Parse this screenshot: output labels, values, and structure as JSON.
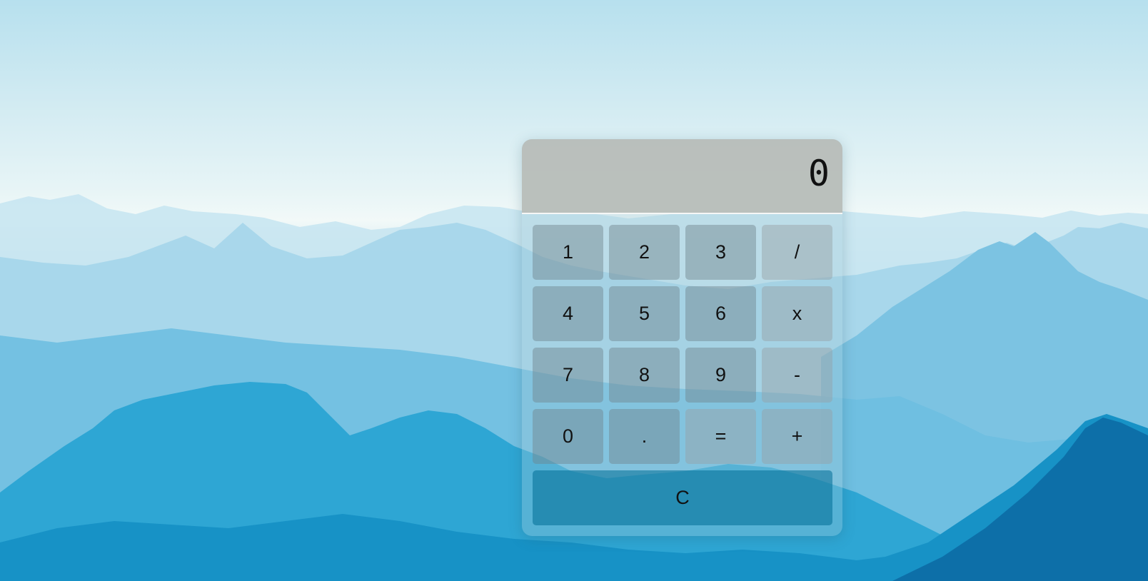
{
  "display": {
    "value": "0"
  },
  "keys": [
    {
      "label": "1",
      "name": "key-1-button",
      "kind": "num"
    },
    {
      "label": "2",
      "name": "key-2-button",
      "kind": "num"
    },
    {
      "label": "3",
      "name": "key-3-button",
      "kind": "num"
    },
    {
      "label": "/",
      "name": "divide-button",
      "kind": "op"
    },
    {
      "label": "4",
      "name": "key-4-button",
      "kind": "num"
    },
    {
      "label": "5",
      "name": "key-5-button",
      "kind": "num"
    },
    {
      "label": "6",
      "name": "key-6-button",
      "kind": "num"
    },
    {
      "label": "x",
      "name": "multiply-button",
      "kind": "op"
    },
    {
      "label": "7",
      "name": "key-7-button",
      "kind": "num"
    },
    {
      "label": "8",
      "name": "key-8-button",
      "kind": "num"
    },
    {
      "label": "9",
      "name": "key-9-button",
      "kind": "num"
    },
    {
      "label": "-",
      "name": "subtract-button",
      "kind": "op"
    },
    {
      "label": "0",
      "name": "key-0-button",
      "kind": "num"
    },
    {
      "label": ".",
      "name": "decimal-button",
      "kind": "num"
    },
    {
      "label": "=",
      "name": "equals-button",
      "kind": "op"
    },
    {
      "label": "+",
      "name": "add-button",
      "kind": "op"
    }
  ],
  "clear": {
    "label": "C"
  },
  "colors": {
    "sky": "#d2ebf2",
    "mountain_far": "#a9d8ec",
    "mountain_mid": "#4fb3dc",
    "mountain_near": "#1a9ccc",
    "mountain_dark": "#0d6fa8"
  }
}
